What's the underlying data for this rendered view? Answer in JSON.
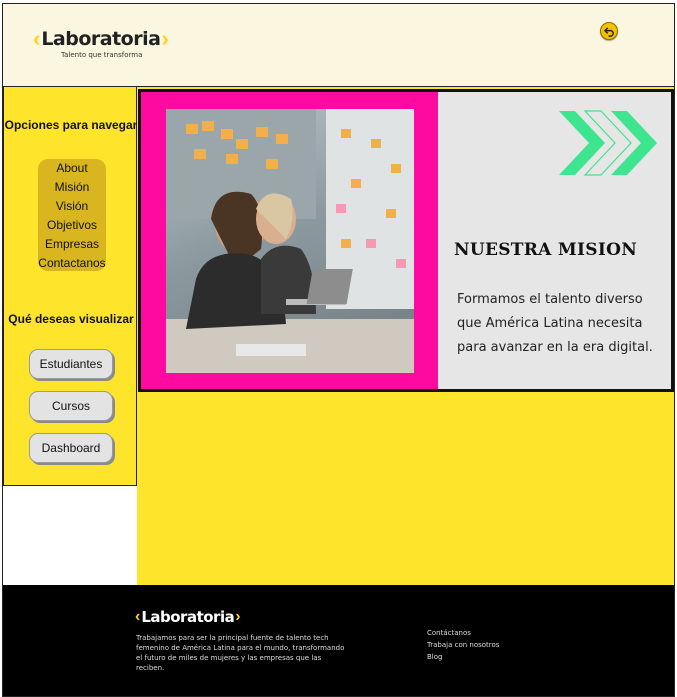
{
  "header": {
    "logo_text": "Laboratoria",
    "logo_tagline": "Talento que transforma",
    "back_icon": "undo-arrow-icon"
  },
  "sidebar": {
    "nav_title": "Opciones para navegar",
    "nav_items": [
      {
        "label": "About"
      },
      {
        "label": "Misión"
      },
      {
        "label": "Visión"
      },
      {
        "label": "Objetivos"
      },
      {
        "label": "Empresas"
      },
      {
        "label": "Contactanos"
      }
    ],
    "view_title": "Qué deseas visualizar",
    "buttons": [
      {
        "label": "Estudiantes"
      },
      {
        "label": "Cursos"
      },
      {
        "label": "Dashboard"
      }
    ]
  },
  "hero": {
    "title": "NUESTRA MISION",
    "text": "Formamos el talento diverso que América Latina necesita para avanzar en la era digital.",
    "colors": {
      "pink": "#ff0aa0",
      "green": "#3ee58f",
      "panel": "#e6e6e6"
    },
    "image_icon": "photo-women-coding-icon"
  },
  "footer": {
    "logo_text": "Laboratoria",
    "description": "Trabajamos para ser la principal fuente de talento tech femenino de América Latina para el mundo, transformando el futuro de miles de mujeres y las empresas que las reciben.",
    "links": [
      {
        "label": "Contáctanos"
      },
      {
        "label": "Trabaja con nosotros"
      },
      {
        "label": "Blog"
      }
    ]
  },
  "colors": {
    "accent_yellow": "#ffe42c",
    "header_bg": "#fbf6e0",
    "footer_bg": "#000000"
  }
}
